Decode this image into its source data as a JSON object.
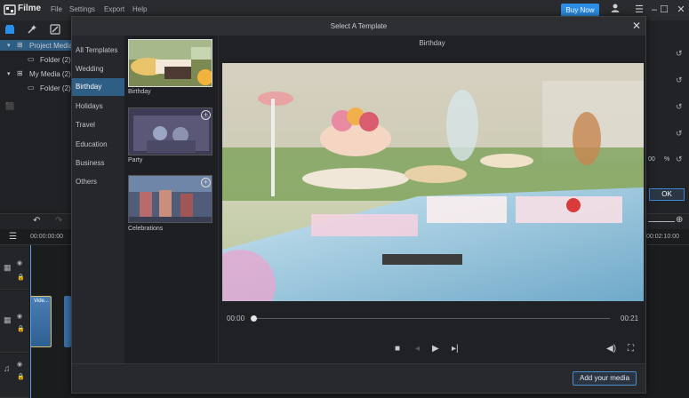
{
  "app": {
    "name": "Filme",
    "menu": [
      "File",
      "Settings",
      "Export",
      "Help"
    ],
    "buy_now": "Buy Now"
  },
  "media_panel": {
    "tree": [
      {
        "label": "Project Media",
        "level": 0,
        "selected": true
      },
      {
        "label": "Folder (2)",
        "level": 1
      },
      {
        "label": "My Media (2)",
        "level": 0
      },
      {
        "label": "Folder (2)",
        "level": 1
      }
    ]
  },
  "timeline": {
    "start_time": "00:00:00:00",
    "end_time": "00:02:10:00",
    "clip_label": "Vide..."
  },
  "right_panel": {
    "percent_value": "00",
    "percent_unit": "%",
    "ok": "OK"
  },
  "dialog": {
    "title": "Select A Template",
    "categories": [
      "All Templates",
      "Wedding",
      "Birthday",
      "Holidays",
      "Travel",
      "Education",
      "Business",
      "Others"
    ],
    "active_category": "Birthday",
    "templates": [
      {
        "label": "Birthday",
        "selected": true
      },
      {
        "label": "Party"
      },
      {
        "label": "Celebrations"
      }
    ],
    "preview_title": "Birthday",
    "current_time": "00:00",
    "duration": "00:21",
    "progress": 0.0,
    "add_media": "Add your media"
  },
  "colors": {
    "accent": "#2b8fe8",
    "selection": "#2f5e85"
  }
}
